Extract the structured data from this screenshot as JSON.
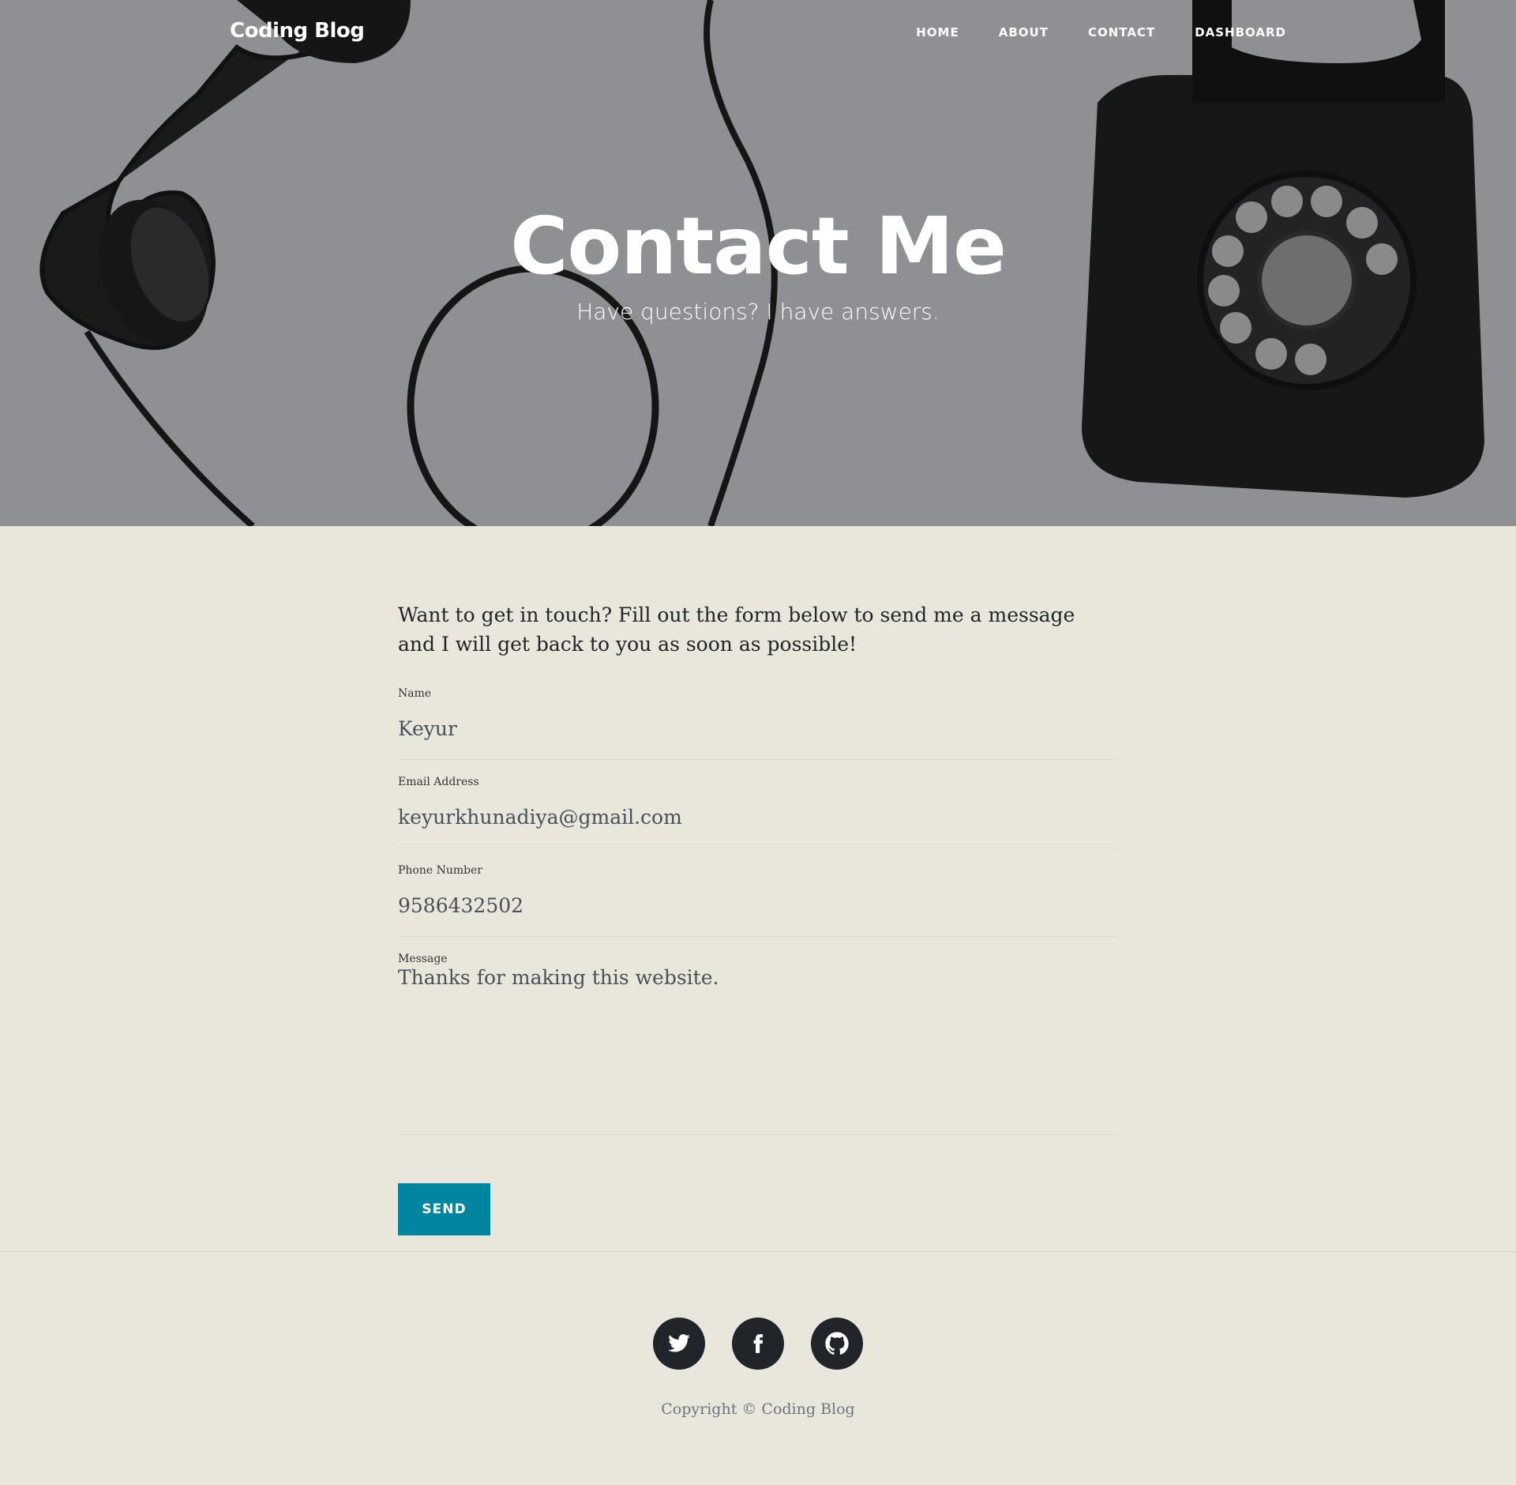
{
  "site": {
    "brand": "Coding Blog"
  },
  "nav": {
    "items": [
      {
        "label": "HOME"
      },
      {
        "label": "ABOUT"
      },
      {
        "label": "CONTACT"
      },
      {
        "label": "DASHBOARD"
      }
    ]
  },
  "hero": {
    "title": "Contact Me",
    "subtitle": "Have questions? I have answers."
  },
  "main": {
    "intro": "Want to get in touch? Fill out the form below to send me a message and I will get back to you as soon as possible!"
  },
  "form": {
    "name": {
      "label": "Name",
      "value": "Keyur"
    },
    "email": {
      "label": "Email Address",
      "value": "keyurkhunadiya@gmail.com"
    },
    "phone": {
      "label": "Phone Number",
      "value": "9586432502"
    },
    "message": {
      "label": "Message",
      "value": "Thanks for making this website."
    },
    "send_label": "SEND"
  },
  "footer": {
    "socials": [
      {
        "icon": "twitter-icon"
      },
      {
        "icon": "facebook-icon"
      },
      {
        "icon": "github-icon"
      }
    ],
    "copyright": "Copyright © Coding Blog"
  },
  "colors": {
    "page_background": "#e9e6dc",
    "hero_overlay": "#8f9093",
    "accent": "#0085a1",
    "footer_icon": "#212529"
  }
}
